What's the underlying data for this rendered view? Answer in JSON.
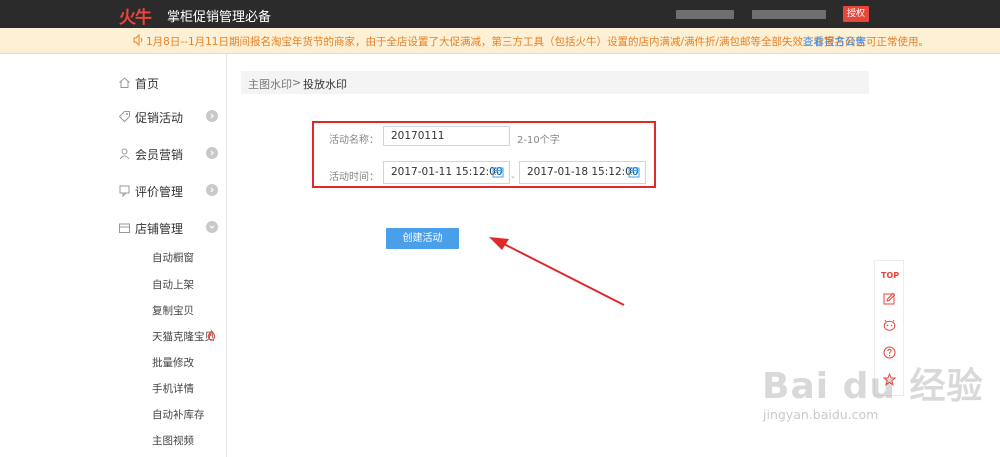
{
  "app": {
    "logo_text": "火牛",
    "title": "掌柜促销管理必备",
    "authorize_label": "授权"
  },
  "notice": {
    "text": "1月8日--1月11日期间报名淘宝年货节的商家，由于全店设置了大促满减，第三方工具（包括火牛）设置的店内满减/满件折/满包邮等全部失效。非报名商家可正常使用。",
    "link_label": "查看官方公告"
  },
  "sidebar": {
    "items": [
      {
        "label": "首页",
        "icon": "home-icon"
      },
      {
        "label": "促销活动",
        "icon": "tag-icon"
      },
      {
        "label": "会员营销",
        "icon": "user-icon"
      },
      {
        "label": "评价管理",
        "icon": "review-icon"
      },
      {
        "label": "店铺管理",
        "icon": "store-icon"
      }
    ],
    "sub_items": [
      "自动橱窗",
      "自动上架",
      "复制宝贝",
      "天猫克隆宝贝",
      "批量修改",
      "手机详情",
      "自动补库存",
      "主图视频"
    ]
  },
  "breadcrumb": {
    "parent": "主图水印",
    "separator": ">",
    "current": "投放水印"
  },
  "form": {
    "name_label": "活动名称：",
    "name_value": "20170111",
    "name_hint": "2-10个字",
    "time_label": "活动时间：",
    "start_time": "2017-01-11 15:12:00",
    "end_time": "2017-01-18 15:12:00",
    "time_separator": "-",
    "create_label": "创建活动"
  },
  "dock": {
    "top_label": "TOP",
    "icons": [
      "edit-icon",
      "chat-icon",
      "help-icon",
      "star-icon"
    ]
  },
  "watermark": {
    "brand": "Bai du 经验",
    "url": "jingyan.baidu.com"
  },
  "colors": {
    "topbar": "#2b2b2b",
    "accent_red": "#e8463a",
    "notice_bg": "#fdf0d5",
    "notice_text": "#e4822a",
    "link_blue": "#3c8ef0",
    "button_blue": "#4a9fea",
    "highlight_box": "#e02a2a"
  }
}
